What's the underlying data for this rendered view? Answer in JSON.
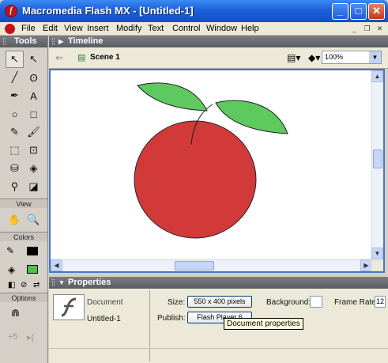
{
  "window": {
    "title": "Macromedia Flash MX - [Untitled-1]",
    "app_icon_letter": "f",
    "controls": {
      "minimize": "_",
      "maximize": "□",
      "close": "✕"
    }
  },
  "menu": {
    "items": [
      "File",
      "Edit",
      "View",
      "Insert",
      "Modify",
      "Text",
      "Control",
      "Window",
      "Help"
    ],
    "mdi": [
      "_",
      "❐",
      "✕"
    ]
  },
  "tools_panel": {
    "title": "Tools",
    "tools": [
      {
        "name": "arrow-tool",
        "glyph": "↖"
      },
      {
        "name": "subselect-tool",
        "glyph": "↖"
      },
      {
        "name": "line-tool",
        "glyph": "╱"
      },
      {
        "name": "lasso-tool",
        "glyph": "ʘ"
      },
      {
        "name": "pen-tool",
        "glyph": "✒"
      },
      {
        "name": "text-tool",
        "glyph": "A"
      },
      {
        "name": "oval-tool",
        "glyph": "○"
      },
      {
        "name": "rectangle-tool",
        "glyph": "□"
      },
      {
        "name": "pencil-tool",
        "glyph": "✎"
      },
      {
        "name": "brush-tool",
        "glyph": "🖌"
      },
      {
        "name": "free-transform-tool",
        "glyph": "⬚"
      },
      {
        "name": "fill-transform-tool",
        "glyph": "⊡"
      },
      {
        "name": "ink-bottle-tool",
        "glyph": "⛁"
      },
      {
        "name": "paint-bucket-tool",
        "glyph": "◈"
      },
      {
        "name": "eyedropper-tool",
        "glyph": "⚲"
      },
      {
        "name": "eraser-tool",
        "glyph": "◪"
      }
    ],
    "view_label": "View",
    "view_tools": [
      {
        "name": "hand-tool",
        "glyph": "✋"
      },
      {
        "name": "zoom-tool",
        "glyph": "🔍"
      }
    ],
    "colors_label": "Colors",
    "stroke_color": "#000000",
    "fill_color": "#4bc24b",
    "options_label": "Options"
  },
  "timeline": {
    "title": "Timeline",
    "scene": "Scene 1",
    "zoom": "100%"
  },
  "stage": {
    "apple_color": "#d23a3a",
    "leaf_color": "#5ec95e"
  },
  "properties": {
    "title": "Properties",
    "doc_type": "Document",
    "doc_name": "Untitled-1",
    "size_label": "Size:",
    "size_value": "550 x 400 pixels",
    "publish_label": "Publish:",
    "publish_value": "Flash Player 6",
    "background_label": "Background:",
    "frame_rate_label": "Frame Rate:",
    "frame_rate_value": "12",
    "tooltip": "Document properties"
  }
}
